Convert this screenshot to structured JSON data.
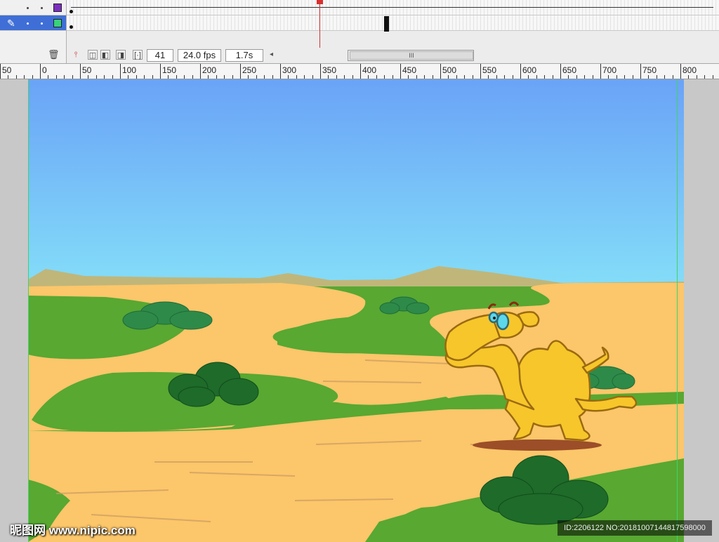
{
  "timeline": {
    "current_frame": "41",
    "frame_rate": "24.0 fps",
    "elapsed_time": "1.7s",
    "scroll_grip": "III"
  },
  "layers": [
    {
      "swatch_color": "#7b2fbf",
      "selected": false
    },
    {
      "swatch_color": "#39d27a",
      "selected": true
    }
  ],
  "ruler": {
    "labels": [
      "50",
      "0",
      "50",
      "100",
      "150",
      "200",
      "250",
      "300",
      "350",
      "400",
      "450",
      "500",
      "550",
      "600",
      "650",
      "700",
      "750",
      "800"
    ]
  },
  "colors": {
    "sky_top": "#6aa3f7",
    "sky_bottom": "#82dcf7",
    "sand": "#fcc66a",
    "grass": "#58a832",
    "bush": "#1e6b2a",
    "camel": "#f7c62a",
    "accent_playhead": "#d93030"
  },
  "watermark": {
    "text": "昵图网 www.nipic.com",
    "id_text": "ID:2206122 NO:20181007144817598000"
  }
}
